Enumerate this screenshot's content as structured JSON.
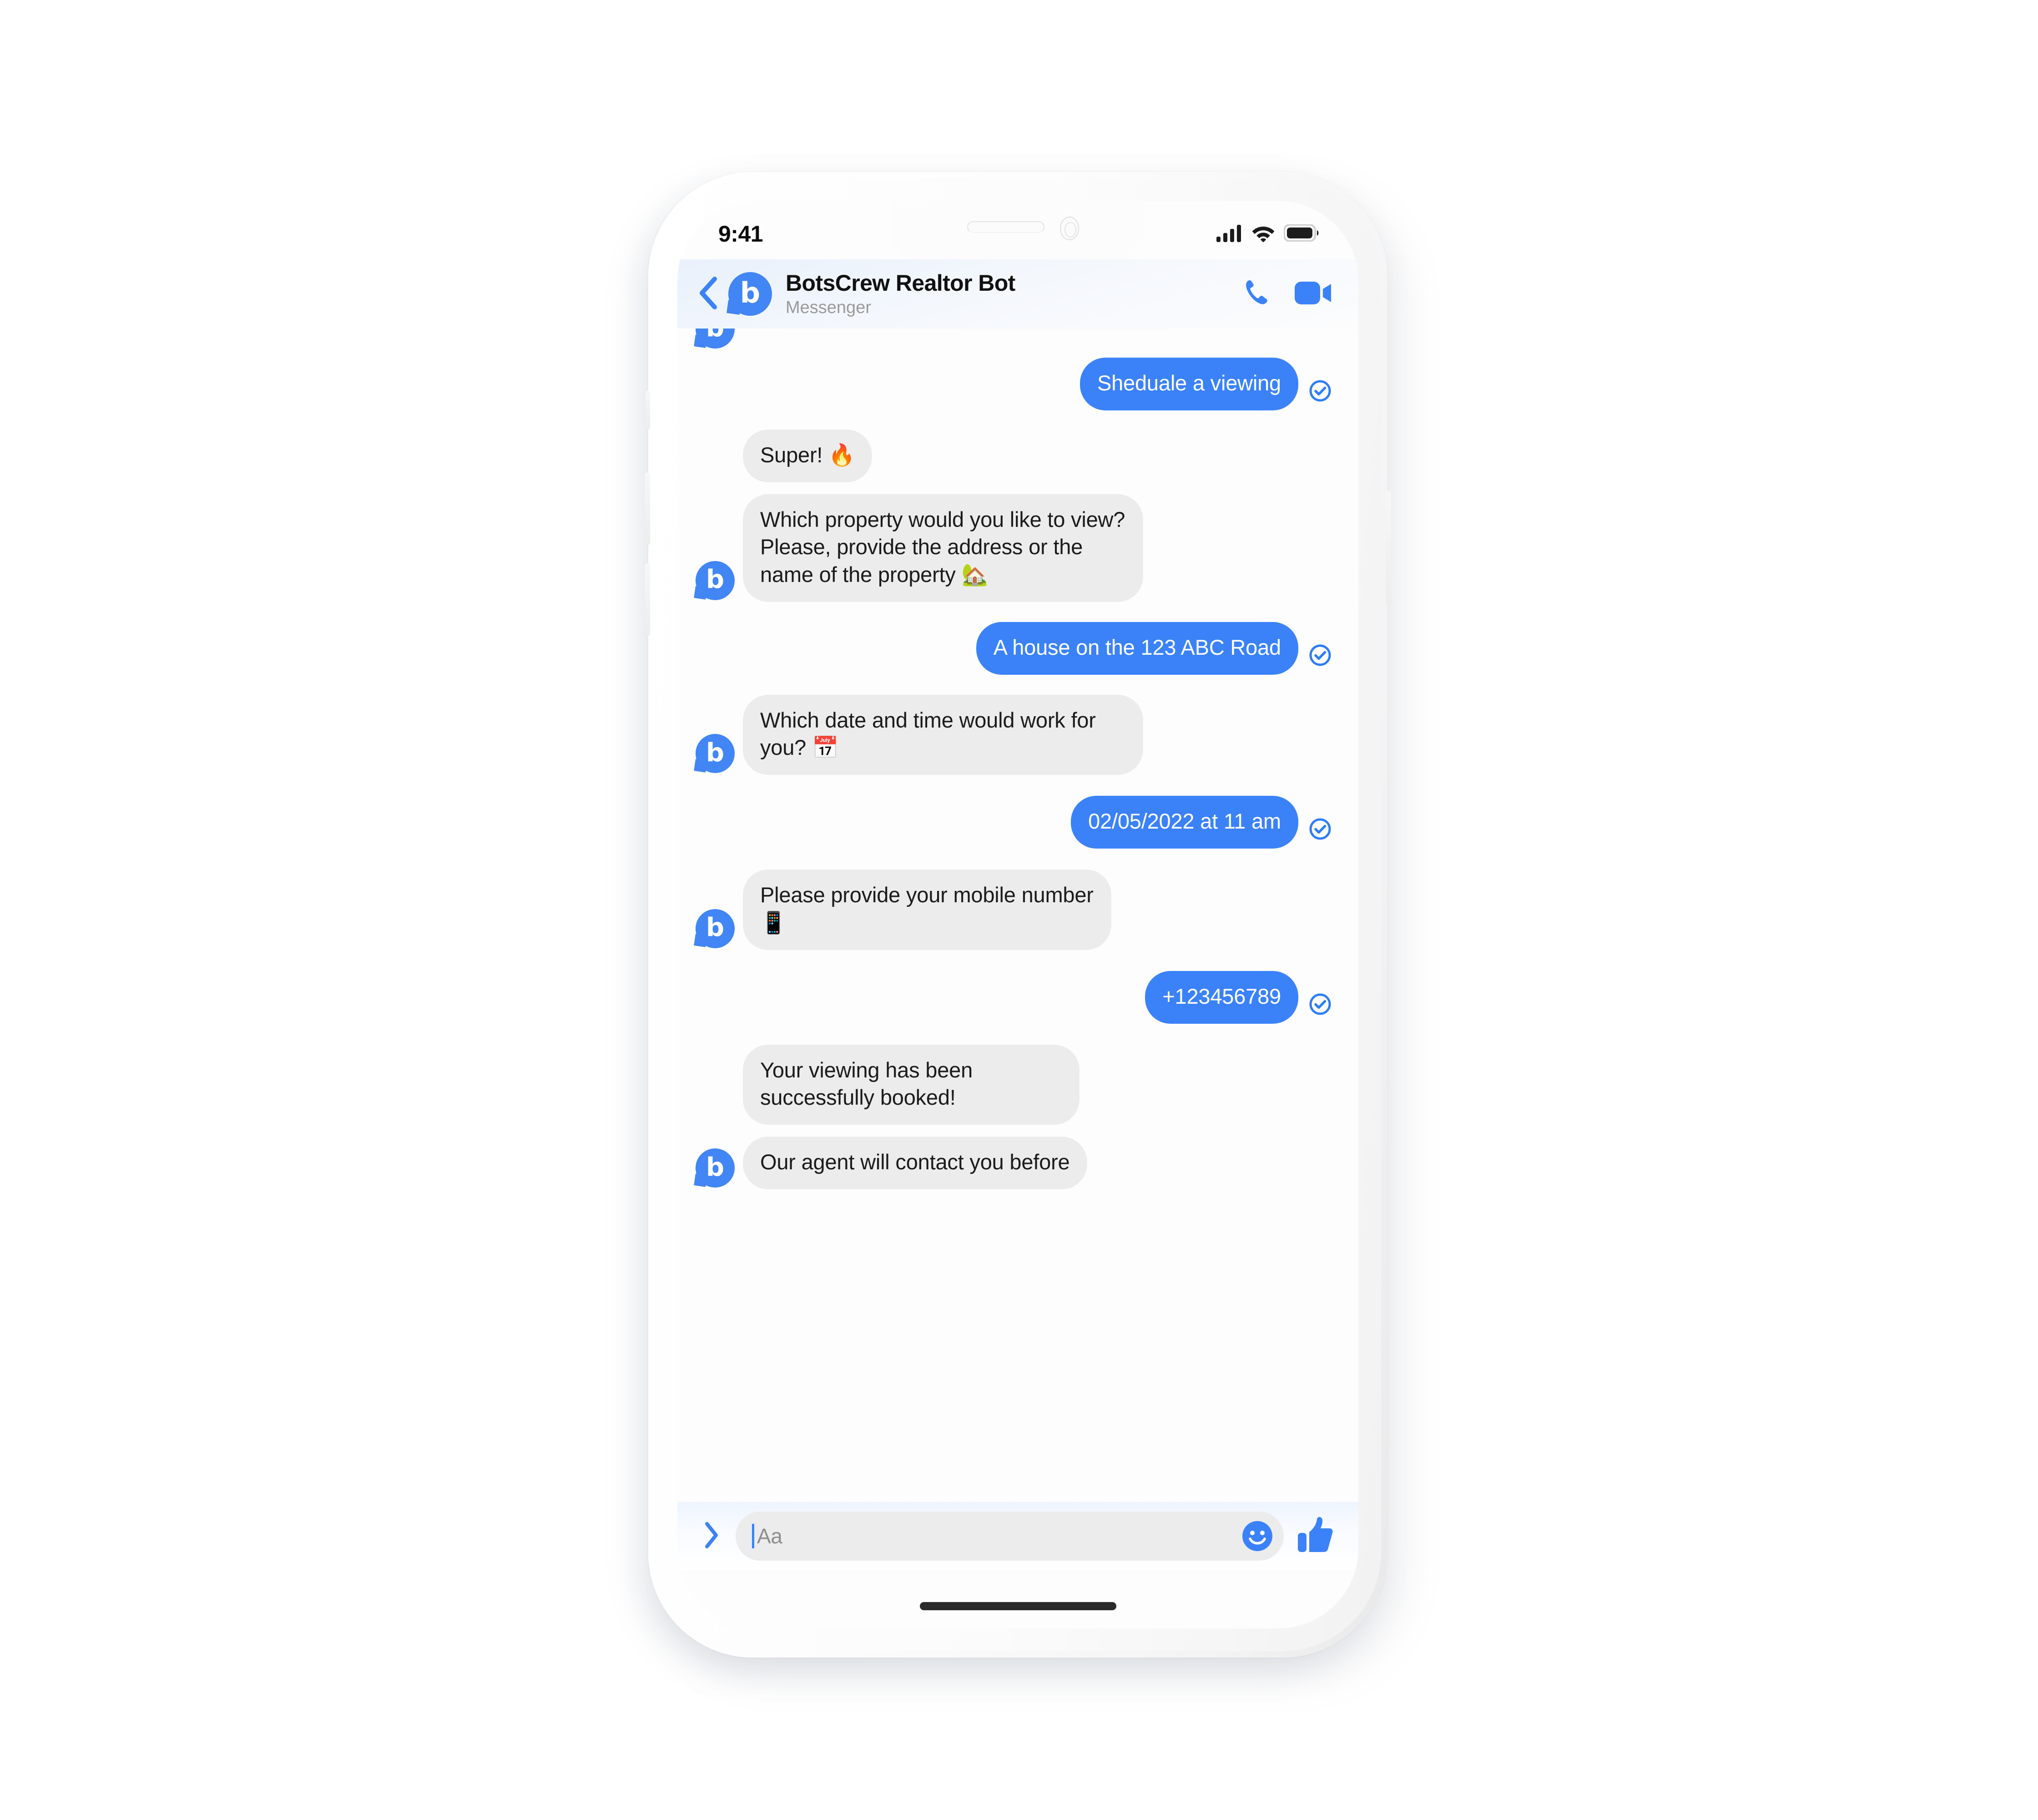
{
  "device": {
    "statusbar": {
      "time": "9:41",
      "signal_icon": "cellular-signal-icon",
      "wifi_icon": "wifi-icon",
      "battery_icon": "battery-full-icon"
    },
    "home_indicator": "home-indicator"
  },
  "header": {
    "back_icon": "chevron-left-icon",
    "avatar_letter": "b",
    "title": "BotsCrew Realtor Bot",
    "subtitle": "Messenger",
    "call_icon": "phone-icon",
    "video_icon": "video-camera-icon"
  },
  "colors": {
    "accent_blue": "#3b82f9",
    "avatar_blue": "#4285f4",
    "bubble_gray": "#ececec",
    "text_dark": "#1b1b1b",
    "text_muted": "#9a9a9a"
  },
  "conversation": {
    "messages": [
      {
        "id": "m1",
        "from": "user",
        "text": "Sheduale a viewing",
        "delivered": true,
        "avatar": false
      },
      {
        "id": "m2",
        "from": "bot",
        "text": "Super! 🔥",
        "delivered": false,
        "avatar": false
      },
      {
        "id": "m3",
        "from": "bot",
        "text": "Which property would you like to view? Please, provide the address or the name of the property 🏡",
        "delivered": false,
        "avatar": true
      },
      {
        "id": "m4",
        "from": "user",
        "text": "A house on the 123 ABC Road",
        "delivered": true,
        "avatar": false
      },
      {
        "id": "m5",
        "from": "bot",
        "text": "Which date and time would work for you? 📅",
        "delivered": false,
        "avatar": true
      },
      {
        "id": "m6",
        "from": "user",
        "text": "02/05/2022 at 11 am",
        "delivered": true,
        "avatar": false
      },
      {
        "id": "m7",
        "from": "bot",
        "text": "Please provide your mobile number 📱",
        "delivered": false,
        "avatar": true
      },
      {
        "id": "m8",
        "from": "user",
        "text": "+123456789",
        "delivered": true,
        "avatar": false
      },
      {
        "id": "m9",
        "from": "bot",
        "text": "Your viewing has been successfully booked!",
        "delivered": false,
        "avatar": false
      },
      {
        "id": "m10",
        "from": "bot",
        "text": "Our agent will contact you before",
        "delivered": false,
        "avatar": true
      }
    ],
    "delivered_icon": "check-circle-icon"
  },
  "composer": {
    "expand_icon": "chevron-right-icon",
    "placeholder": "Aa",
    "value": "",
    "emoji_icon": "smiley-face-icon",
    "like_icon": "thumbs-up-icon"
  }
}
